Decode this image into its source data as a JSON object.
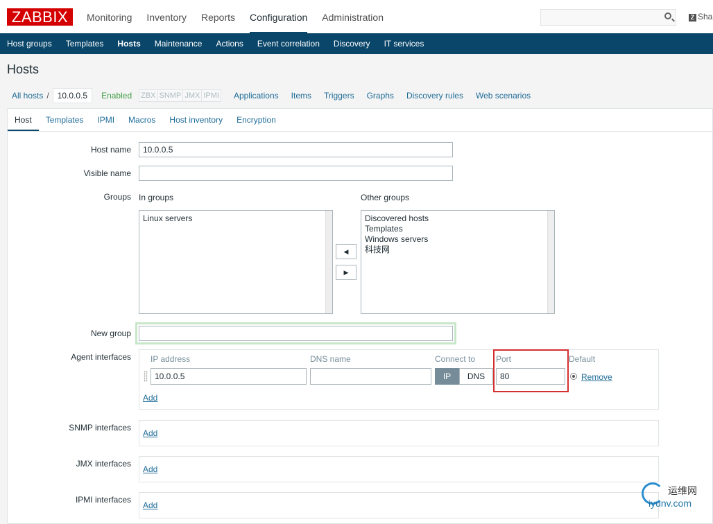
{
  "app": {
    "logo": "ZABBIX",
    "share_label": "Sha",
    "share_icon_letter": "Z"
  },
  "top_menu": [
    {
      "label": "Monitoring"
    },
    {
      "label": "Inventory"
    },
    {
      "label": "Reports"
    },
    {
      "label": "Configuration",
      "active": true
    },
    {
      "label": "Administration"
    }
  ],
  "search": {
    "placeholder": "",
    "icon": "search-icon"
  },
  "sub_menu": [
    {
      "label": "Host groups"
    },
    {
      "label": "Templates"
    },
    {
      "label": "Hosts",
      "active": true
    },
    {
      "label": "Maintenance"
    },
    {
      "label": "Actions"
    },
    {
      "label": "Event correlation"
    },
    {
      "label": "Discovery"
    },
    {
      "label": "IT services"
    }
  ],
  "page_title": "Hosts",
  "breadcrumb": {
    "all_hosts": "All hosts",
    "separator": "/",
    "current": "10.0.0.5",
    "status": "Enabled"
  },
  "availability_badges": [
    "ZBX",
    "SNMP",
    "JMX",
    "IPMI"
  ],
  "host_nav": [
    "Applications",
    "Items",
    "Triggers",
    "Graphs",
    "Discovery rules",
    "Web scenarios"
  ],
  "tabs": [
    {
      "label": "Host",
      "active": true
    },
    {
      "label": "Templates"
    },
    {
      "label": "IPMI"
    },
    {
      "label": "Macros"
    },
    {
      "label": "Host inventory"
    },
    {
      "label": "Encryption"
    }
  ],
  "form": {
    "host_name_label": "Host name",
    "host_name_value": "10.0.0.5",
    "visible_name_label": "Visible name",
    "visible_name_value": "",
    "groups_label": "Groups",
    "in_groups_label": "In groups",
    "other_groups_label": "Other groups",
    "in_groups": [
      "Linux servers"
    ],
    "other_groups": [
      "Discovered hosts",
      "Templates",
      "Windows servers",
      "科技网"
    ],
    "move_left": "◀",
    "move_right": "▶",
    "new_group_label": "New group",
    "new_group_value": "",
    "agent_interfaces_label": "Agent interfaces",
    "agent_headers": {
      "ip": "IP address",
      "dns": "DNS name",
      "connect": "Connect to",
      "port": "Port",
      "default": "Default"
    },
    "agent_row": {
      "ip": "10.0.0.5",
      "dns": "",
      "connect_ip": "IP",
      "connect_dns": "DNS",
      "port": "80",
      "remove": "Remove"
    },
    "add_label": "Add",
    "snmp_interfaces_label": "SNMP interfaces",
    "jmx_interfaces_label": "JMX interfaces",
    "ipmi_interfaces_label": "IPMI interfaces"
  },
  "watermark": {
    "top": "运维网",
    "bottom": "iyunv.com"
  }
}
